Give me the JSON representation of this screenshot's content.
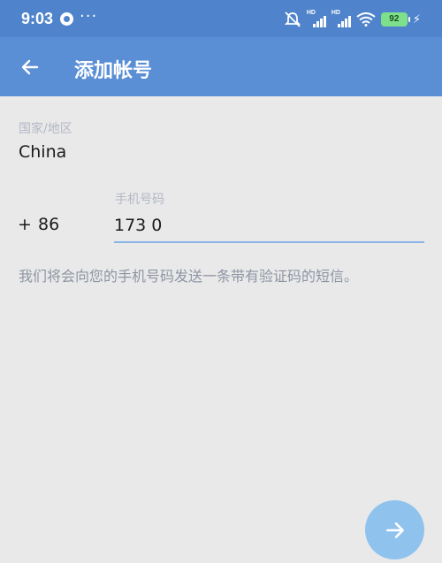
{
  "status_bar": {
    "time": "9:03",
    "more": "···",
    "battery_level": "92",
    "icons": [
      "notification-app-icon",
      "mute-icon",
      "hd-signal-icon",
      "hd-signal-icon",
      "wifi-icon",
      "battery-icon",
      "charging-icon"
    ]
  },
  "appbar": {
    "title": "添加帐号",
    "back_icon": "arrow-left-icon",
    "color": "#5a8fd6"
  },
  "form": {
    "country_label": "国家/地区",
    "country_value": "China",
    "code_plus": "+",
    "country_code": "86",
    "phone_label": "手机号码",
    "phone_value": "173 0",
    "hint": "我们将会向您的手机号码发送一条带有验证码的短信。"
  },
  "fab": {
    "icon": "arrow-right-icon",
    "color": "#8fc3ee"
  }
}
